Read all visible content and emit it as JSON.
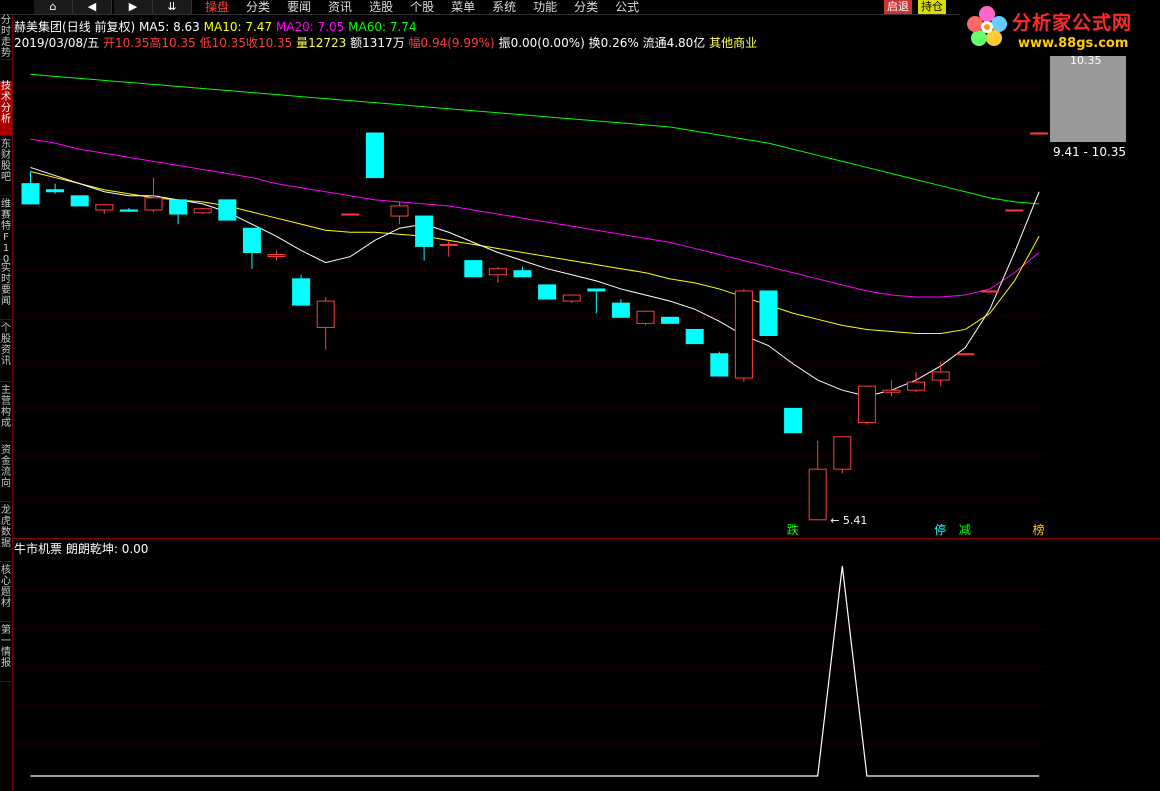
{
  "toolbar": {
    "home": "⌂",
    "back": "◀",
    "forward": "▶",
    "down": "⇊",
    "menu": [
      "操盘",
      "分类",
      "要闻",
      "资讯",
      "选股",
      "个股",
      "菜单",
      "系统",
      "功能",
      "分类",
      "公式"
    ],
    "right_buttons": [
      "启退",
      "持仓"
    ]
  },
  "logo": {
    "title": "分析家公式网",
    "url": "www.88gs.com"
  },
  "sidebar": [
    "分时走势",
    "技术分析",
    "东财股吧",
    "维赛特F10",
    "实时要闻",
    "个股资讯",
    "主营构成",
    "资金流向",
    "龙虎数据",
    "核心题材",
    "第一情报"
  ],
  "stock": {
    "name": "赫美集团",
    "period": "(日线 前复权)",
    "ma5": "MA5: 8.63",
    "ma10": "MA10: 7.47",
    "ma20": "MA20: 7.05",
    "ma60": "MA60: 7.74",
    "date": "2019/03/08/五",
    "open": "开10.35",
    "high": "高10.35",
    "low": "低10.35",
    "close": "收10.35",
    "volume": "量12723",
    "amount": "额1317万",
    "change": "幅0.94(9.99%)",
    "amplitude": "振0.00(0.00%)",
    "turnover": "换0.26%",
    "float": "流通4.80亿",
    "sector": "其他商业"
  },
  "price_panel": {
    "top": "10.35",
    "range": "9.41 - 10.35"
  },
  "annotations": {
    "low_price": "5.41",
    "die": "跌",
    "ting": "停",
    "jian": "减",
    "bang": "榜"
  },
  "indicator": {
    "title": "牛市机票",
    "value": "朗朗乾坤: 0.00"
  },
  "colors": {
    "up": "#ff3c3c",
    "down": "#00ffff",
    "ma5": "#ffffff",
    "ma10": "#ffff00",
    "ma20": "#ff00ff",
    "ma60": "#00ff00",
    "text_red": "#ff3c3c",
    "text_yellow": "#ffff55"
  },
  "chart_data": {
    "type": "candlestick",
    "candles": [
      {
        "o": 4.2,
        "h": 4.5,
        "l": 3.7,
        "c": 3.7
      },
      {
        "o": 4.05,
        "h": 4.2,
        "l": 3.95,
        "c": 4.0
      },
      {
        "o": 3.9,
        "h": 3.9,
        "l": 3.65,
        "c": 3.65
      },
      {
        "o": 3.55,
        "h": 3.7,
        "l": 3.45,
        "c": 3.68
      },
      {
        "o": 3.55,
        "h": 3.6,
        "l": 3.5,
        "c": 3.52
      },
      {
        "o": 3.55,
        "h": 4.35,
        "l": 3.5,
        "c": 3.85
      },
      {
        "o": 3.8,
        "h": 3.8,
        "l": 3.2,
        "c": 3.45
      },
      {
        "o": 3.48,
        "h": 3.6,
        "l": 3.45,
        "c": 3.58
      },
      {
        "o": 3.8,
        "h": 3.8,
        "l": 3.3,
        "c": 3.3
      },
      {
        "o": 3.1,
        "h": 3.1,
        "l": 2.1,
        "c": 2.5
      },
      {
        "o": 2.4,
        "h": 2.55,
        "l": 2.3,
        "c": 2.45
      },
      {
        "o": 1.85,
        "h": 1.95,
        "l": 1.2,
        "c": 1.2
      },
      {
        "o": 0.65,
        "h": 1.4,
        "l": 0.1,
        "c": 1.3
      },
      {
        "o": 3.45,
        "h": 3.45,
        "l": 3.45,
        "c": 3.45
      },
      {
        "o": 5.45,
        "h": 5.45,
        "l": 4.35,
        "c": 4.35
      },
      {
        "o": 3.4,
        "h": 3.75,
        "l": 3.2,
        "c": 3.65
      },
      {
        "o": 3.4,
        "h": 3.4,
        "l": 2.3,
        "c": 2.65
      },
      {
        "o": 2.7,
        "h": 2.8,
        "l": 2.4,
        "c": 2.7
      },
      {
        "o": 2.3,
        "h": 2.3,
        "l": 1.9,
        "c": 1.9
      },
      {
        "o": 1.95,
        "h": 2.15,
        "l": 1.75,
        "c": 2.1
      },
      {
        "o": 2.05,
        "h": 2.15,
        "l": 1.9,
        "c": 1.9
      },
      {
        "o": 1.7,
        "h": 1.7,
        "l": 1.35,
        "c": 1.35
      },
      {
        "o": 1.3,
        "h": 1.45,
        "l": 1.25,
        "c": 1.45
      },
      {
        "o": 1.6,
        "h": 1.6,
        "l": 1.0,
        "c": 1.55
      },
      {
        "o": 1.25,
        "h": 1.35,
        "l": 0.9,
        "c": 0.9
      },
      {
        "o": 0.75,
        "h": 1.05,
        "l": 0.7,
        "c": 1.05
      },
      {
        "o": 0.9,
        "h": 0.9,
        "l": 0.75,
        "c": 0.75
      },
      {
        "o": 0.6,
        "h": 0.6,
        "l": 0.25,
        "c": 0.25
      },
      {
        "o": 0.0,
        "h": 0.05,
        "l": -0.55,
        "c": -0.55
      },
      {
        "o": -0.6,
        "h": 1.6,
        "l": -0.7,
        "c": 1.55
      },
      {
        "o": 1.55,
        "h": 1.55,
        "l": 0.45,
        "c": 0.45
      },
      {
        "o": -1.35,
        "h": -1.35,
        "l": -1.95,
        "c": -1.95
      },
      {
        "o": -4.1,
        "h": -2.15,
        "l": -4.1,
        "c": -2.85
      },
      {
        "o": -2.85,
        "h": -2.05,
        "l": -2.95,
        "c": -2.05
      },
      {
        "o": -1.7,
        "h": -0.9,
        "l": -1.75,
        "c": -0.8
      },
      {
        "o": -0.95,
        "h": -0.65,
        "l": -1.05,
        "c": -0.9
      },
      {
        "o": -0.9,
        "h": -0.45,
        "l": -0.95,
        "c": -0.7
      },
      {
        "o": -0.65,
        "h": -0.2,
        "l": -0.8,
        "c": -0.45
      },
      {
        "o": 0.0,
        "h": 0.0,
        "l": 0.0,
        "c": 0.0
      },
      {
        "o": 1.55,
        "h": 1.55,
        "l": 1.55,
        "c": 1.55
      },
      {
        "o": 3.55,
        "h": 3.55,
        "l": 3.55,
        "c": 3.55
      },
      {
        "o": 5.45,
        "h": 5.45,
        "l": 5.45,
        "c": 5.45
      }
    ],
    "ma5": [
      4.6,
      4.4,
      4.2,
      4.0,
      3.9,
      3.9,
      3.8,
      3.7,
      3.5,
      3.2,
      2.9,
      2.55,
      2.25,
      2.4,
      2.8,
      3.1,
      3.2,
      3.0,
      2.75,
      2.5,
      2.3,
      2.1,
      1.95,
      1.8,
      1.6,
      1.45,
      1.3,
      1.1,
      0.8,
      0.45,
      0.2,
      -0.25,
      -0.65,
      -0.9,
      -1.05,
      -0.9,
      -0.65,
      -0.3,
      0.15,
      1.1,
      2.5,
      4.0
    ],
    "ma10": [
      4.5,
      4.35,
      4.2,
      4.05,
      3.95,
      3.85,
      3.8,
      3.75,
      3.65,
      3.5,
      3.35,
      3.2,
      3.05,
      3.0,
      3.0,
      2.95,
      2.9,
      2.8,
      2.7,
      2.6,
      2.5,
      2.4,
      2.3,
      2.2,
      2.1,
      2.0,
      1.85,
      1.75,
      1.6,
      1.4,
      1.2,
      1.0,
      0.85,
      0.7,
      0.6,
      0.55,
      0.5,
      0.5,
      0.6,
      1.0,
      1.8,
      2.9
    ],
    "ma20": [
      5.3,
      5.2,
      5.05,
      4.95,
      4.85,
      4.75,
      4.65,
      4.55,
      4.45,
      4.35,
      4.2,
      4.1,
      4.0,
      3.9,
      3.8,
      3.75,
      3.7,
      3.65,
      3.55,
      3.45,
      3.35,
      3.25,
      3.15,
      3.05,
      2.95,
      2.85,
      2.75,
      2.6,
      2.45,
      2.3,
      2.15,
      2.0,
      1.85,
      1.7,
      1.55,
      1.45,
      1.4,
      1.4,
      1.45,
      1.6,
      2.0,
      2.5
    ],
    "ma60": [
      6.9,
      6.85,
      6.8,
      6.75,
      6.7,
      6.65,
      6.6,
      6.55,
      6.5,
      6.45,
      6.4,
      6.35,
      6.3,
      6.25,
      6.2,
      6.15,
      6.1,
      6.05,
      6.0,
      5.95,
      5.9,
      5.85,
      5.8,
      5.75,
      5.7,
      5.65,
      5.6,
      5.5,
      5.4,
      5.3,
      5.2,
      5.05,
      4.9,
      4.75,
      4.6,
      4.45,
      4.3,
      4.15,
      4.0,
      3.85,
      3.75,
      3.7
    ],
    "indicator": [
      0,
      0,
      0,
      0,
      0,
      0,
      0,
      0,
      0,
      0,
      0,
      0,
      0,
      0,
      0,
      0,
      0,
      0,
      0,
      0,
      0,
      0,
      0,
      0,
      0,
      0,
      0,
      0,
      0,
      0,
      0,
      0,
      0,
      1,
      0,
      0,
      0,
      0,
      0,
      0,
      0,
      0
    ]
  }
}
